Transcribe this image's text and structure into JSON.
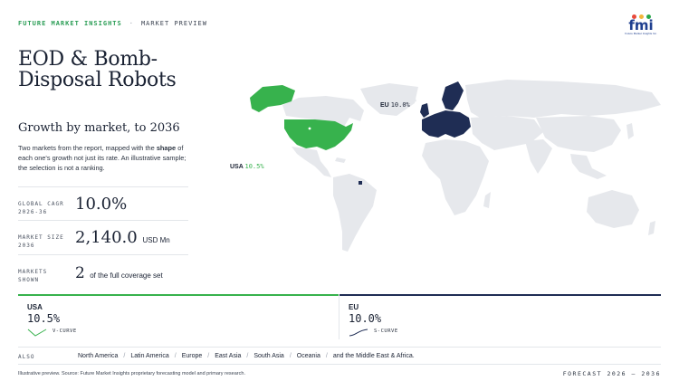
{
  "header": {
    "brand": "FUTURE MARKET INSIGHTS",
    "separator": "·",
    "section": "MARKET PREVIEW",
    "logo_text": "fmi",
    "logo_sub": "Future Market Insights Inc.",
    "logo_dot_colors": [
      "#e84a3c",
      "#f2b53a",
      "#2aa84a",
      "#2f6fd8"
    ]
  },
  "title": "EOD & Bomb-Disposal Robots",
  "subtitle": "Growth by market, to 2036",
  "description": {
    "part1": "Two markets from the report, mapped with the ",
    "bold": "shape",
    "part2": " of each one's growth not just its rate. An illustrative sample; the selection is not a ranking."
  },
  "stats": [
    {
      "label_line1": "GLOBAL CAGR",
      "label_line2": "2026-36",
      "value": "10.0%",
      "unit": ""
    },
    {
      "label_line1": "MARKET SIZE",
      "label_line2": "2036",
      "value": "2,140.0",
      "unit": "USD Mn"
    },
    {
      "label_line1": "MARKETS",
      "label_line2": "SHOWN",
      "value": "2",
      "unit": "of the full coverage set"
    }
  ],
  "map": {
    "labels": [
      {
        "name": "EU",
        "pct": "10.0%"
      },
      {
        "name": "USA",
        "pct": "10.5%"
      }
    ],
    "colors": {
      "land": "#e6e8ec",
      "usa": "#37b24d",
      "eu": "#1f2d54"
    }
  },
  "cards": [
    {
      "name": "USA",
      "value": "10.5%",
      "shape": "V-CURVE",
      "color": "#37b24d"
    },
    {
      "name": "EU",
      "value": "10.0%",
      "shape": "S-CURVE",
      "color": "#1f2d54"
    }
  ],
  "also": {
    "label": "ALSO",
    "regions": [
      "North America",
      "Latin America",
      "Europe",
      "East Asia",
      "South Asia",
      "Oceania",
      "and the Middle East & Africa."
    ],
    "separator": "/"
  },
  "footer": {
    "note": "Illustrative preview. Source: Future Market Insights proprietary forecasting model and primary research.",
    "range": "FORECAST 2026 – 2036"
  }
}
